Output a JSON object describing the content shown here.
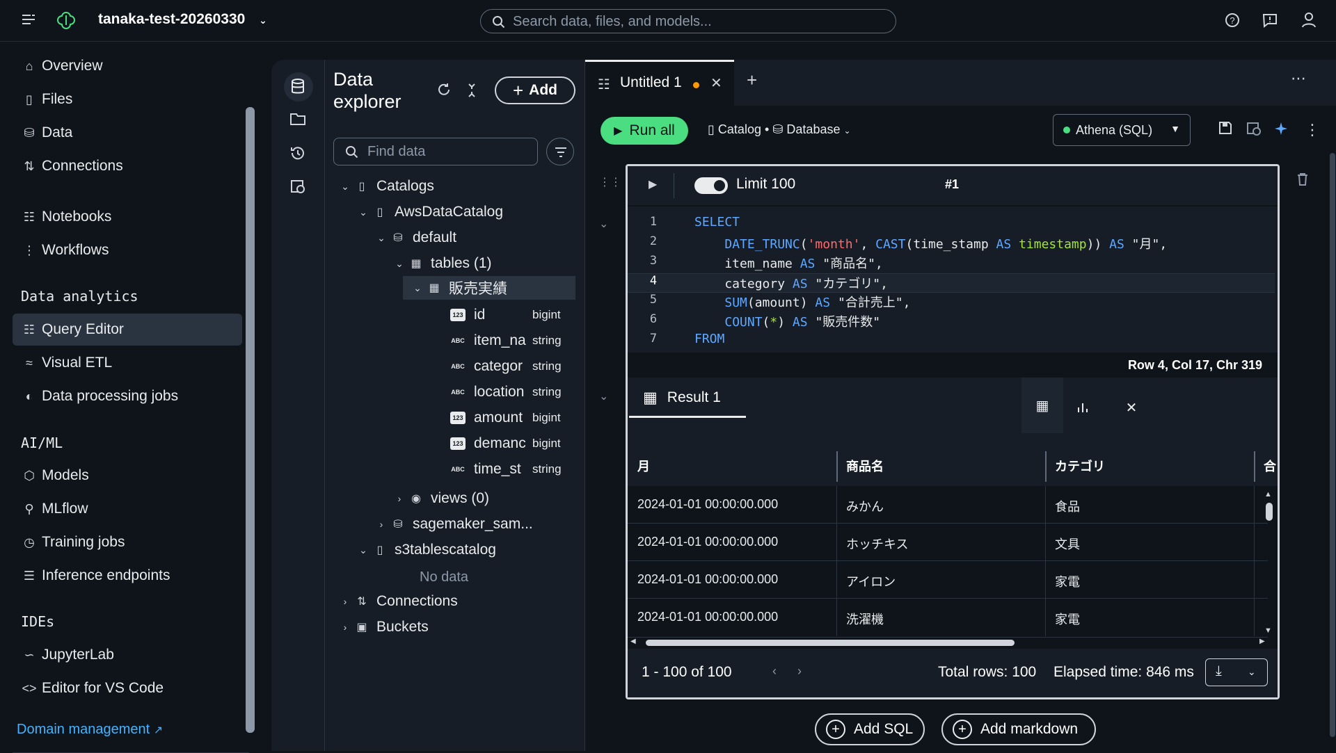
{
  "topbar": {
    "project": "tanaka-test-20260330",
    "search_placeholder": "Search data, files, and models..."
  },
  "nav": {
    "items_top": [
      "Overview",
      "Files",
      "Data",
      "Connections"
    ],
    "items_build": [
      "Notebooks",
      "Workflows"
    ],
    "section_data_analytics": "Data analytics",
    "items_analytics": [
      "Query Editor",
      "Visual ETL",
      "Data processing jobs"
    ],
    "section_aiml": "AI/ML",
    "items_aiml": [
      "Models",
      "MLflow",
      "Training jobs",
      "Inference endpoints"
    ],
    "section_ides": "IDEs",
    "items_ides": [
      "JupyterLab",
      "Editor for VS Code"
    ],
    "domain_management": "Domain management",
    "active": "Query Editor"
  },
  "explorer": {
    "title": "Data explorer",
    "add_label": "Add",
    "find_placeholder": "Find data",
    "catalogs": "Catalogs",
    "aws_catalog": "AwsDataCatalog",
    "default_db": "default",
    "tables": "tables (1)",
    "table_name": "販売実績",
    "columns": [
      {
        "name": "id",
        "type": "bigint",
        "kind": "123"
      },
      {
        "name": "item_na",
        "type": "string",
        "kind": "ABC"
      },
      {
        "name": "categor",
        "type": "string",
        "kind": "ABC"
      },
      {
        "name": "location",
        "type": "string",
        "kind": "ABC"
      },
      {
        "name": "amount",
        "type": "bigint",
        "kind": "123"
      },
      {
        "name": "demanc",
        "type": "bigint",
        "kind": "123"
      },
      {
        "name": "time_st",
        "type": "string",
        "kind": "ABC"
      }
    ],
    "views": "views (0)",
    "sagemaker": "sagemaker_sam...",
    "s3tables": "s3tablescatalog",
    "no_data": "No data",
    "connections": "Connections",
    "buckets": "Buckets"
  },
  "editor": {
    "tab_title": "Untitled 1",
    "run_all": "Run all",
    "catalog": "Catalog",
    "database": "Database",
    "engine": "Athena (SQL)",
    "limit_label": "Limit 100",
    "cell_number": "#1",
    "code_lines": [
      {
        "n": "1",
        "parts": [
          [
            "kw",
            "SELECT"
          ]
        ]
      },
      {
        "n": "2",
        "parts": [
          [
            "",
            "    "
          ],
          [
            "fn",
            "DATE_TRUNC"
          ],
          [
            "",
            "("
          ],
          [
            "str",
            "'month'"
          ],
          [
            "",
            ", "
          ],
          [
            "fn",
            "CAST"
          ],
          [
            "",
            "(time_stamp "
          ],
          [
            "kw",
            "AS"
          ],
          [
            "",
            " "
          ],
          [
            "ty",
            "timestamp"
          ],
          [
            "",
            ")) "
          ],
          [
            "kw",
            "AS"
          ],
          [
            "",
            " \"月\","
          ]
        ]
      },
      {
        "n": "3",
        "parts": [
          [
            "",
            "    item_name "
          ],
          [
            "kw",
            "AS"
          ],
          [
            "",
            " \"商品名\","
          ]
        ]
      },
      {
        "n": "4",
        "parts": [
          [
            "",
            "    category "
          ],
          [
            "kw",
            "AS"
          ],
          [
            "",
            " \"カテゴリ\","
          ]
        ]
      },
      {
        "n": "5",
        "parts": [
          [
            "",
            "    "
          ],
          [
            "fn",
            "SUM"
          ],
          [
            "",
            "(amount) "
          ],
          [
            "kw",
            "AS"
          ],
          [
            "",
            " \"合計売上\","
          ]
        ]
      },
      {
        "n": "6",
        "parts": [
          [
            "",
            "    "
          ],
          [
            "fn",
            "COUNT"
          ],
          [
            "",
            "("
          ],
          [
            "ty",
            "*"
          ],
          [
            "",
            ") "
          ],
          [
            "kw",
            "AS"
          ],
          [
            "",
            " \"販売件数\""
          ]
        ]
      },
      {
        "n": "7",
        "parts": [
          [
            "kw",
            "FROM"
          ]
        ]
      }
    ],
    "cursor_status": "Row 4, Col 17, Chr 319",
    "result_tab": "Result 1",
    "columns": [
      "月",
      "商品名",
      "カテゴリ",
      "合"
    ],
    "rows": [
      [
        "2024-01-01 00:00:00.000",
        "みかん",
        "食品"
      ],
      [
        "2024-01-01 00:00:00.000",
        "ホッチキス",
        "文具"
      ],
      [
        "2024-01-01 00:00:00.000",
        "アイロン",
        "家電"
      ],
      [
        "2024-01-01 00:00:00.000",
        "洗濯機",
        "家電"
      ]
    ],
    "range": "1 - 100 of 100",
    "total_rows": "Total rows: 100",
    "elapsed": "Elapsed time: 846 ms",
    "add_sql": "Add SQL",
    "add_markdown": "Add markdown"
  }
}
